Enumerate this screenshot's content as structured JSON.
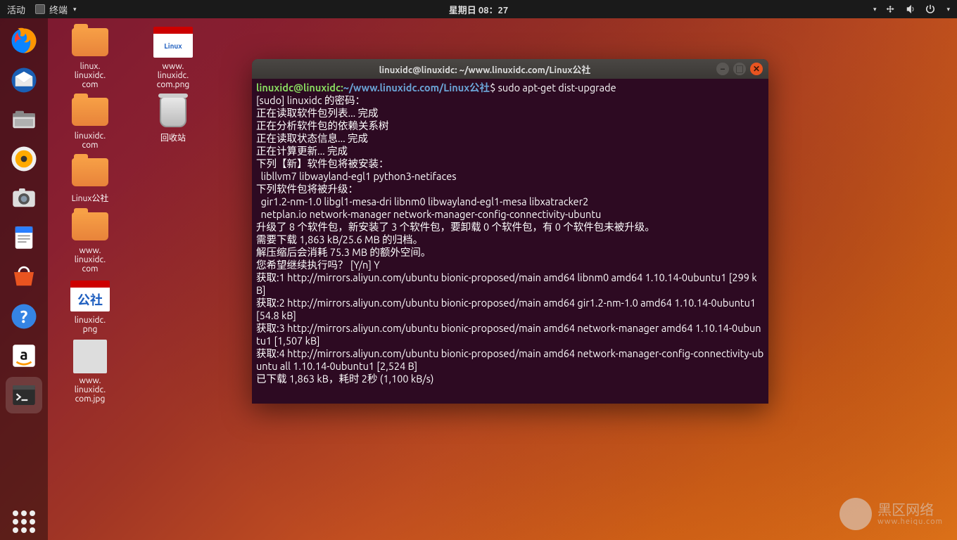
{
  "topbar": {
    "activities": "活动",
    "app_label": "终端",
    "clock": "星期日 08：27"
  },
  "dock": {
    "items": [
      "firefox",
      "thunderbird",
      "files",
      "rhythmbox",
      "photos",
      "writer",
      "software",
      "help",
      "amazon",
      "terminal"
    ]
  },
  "desktop": {
    "col1": [
      {
        "type": "folder",
        "label": "linux.\nlinuxidc.\ncom"
      },
      {
        "type": "folder",
        "label": "linuxidc.\ncom"
      },
      {
        "type": "folder",
        "label": "Linux公社"
      },
      {
        "type": "folder",
        "label": "www.\nlinuxidc.\ncom"
      },
      {
        "type": "login",
        "label": "linuxidc.\npng"
      },
      {
        "type": "photo",
        "label": "www.\nlinuxidc.\ncom.jpg"
      }
    ],
    "col2": [
      {
        "type": "login",
        "label": "www.\nlinuxidc.\ncom.png"
      },
      {
        "type": "trash",
        "label": "回收站"
      }
    ]
  },
  "terminal": {
    "title": "linuxidc@linuxidc: ~/www.linuxidc.com/Linux公社",
    "prompt_user": "linuxidc@linuxidc",
    "prompt_sep": ":",
    "prompt_path": "~/www.linuxidc.com/Linux公社",
    "prompt_dollar": "$",
    "command": " sudo apt-get dist-upgrade",
    "output": "[sudo] linuxidc 的密码：\n正在读取软件包列表... 完成\n正在分析软件包的依赖关系树\n正在读取状态信息... 完成\n正在计算更新... 完成\n下列【新】软件包将被安装：\n  libllvm7 libwayland-egl1 python3-netifaces\n下列软件包将被升级：\n  gir1.2-nm-1.0 libgl1-mesa-dri libnm0 libwayland-egl1-mesa libxatracker2\n  netplan.io network-manager network-manager-config-connectivity-ubuntu\n升级了 8 个软件包，新安装了 3 个软件包，要卸载 0 个软件包，有 0 个软件包未被升级。\n需要下载 1,863 kB/25.6 MB 的归档。\n解压缩后会消耗 75.3 MB 的额外空间。\n您希望继续执行吗？ [Y/n] Y\n获取:1 http://mirrors.aliyun.com/ubuntu bionic-proposed/main amd64 libnm0 amd64 1.10.14-0ubuntu1 [299 kB]\n获取:2 http://mirrors.aliyun.com/ubuntu bionic-proposed/main amd64 gir1.2-nm-1.0 amd64 1.10.14-0ubuntu1 [54.8 kB]\n获取:3 http://mirrors.aliyun.com/ubuntu bionic-proposed/main amd64 network-manager amd64 1.10.14-0ubuntu1 [1,507 kB]\n获取:4 http://mirrors.aliyun.com/ubuntu bionic-proposed/main amd64 network-manager-config-connectivity-ubuntu all 1.10.14-0ubuntu1 [2,524 B]\n已下载 1,863 kB，耗时 2秒 (1,100 kB/s)"
  },
  "watermark": {
    "big": "黑区网络",
    "sub": "www.heiqu.com"
  }
}
